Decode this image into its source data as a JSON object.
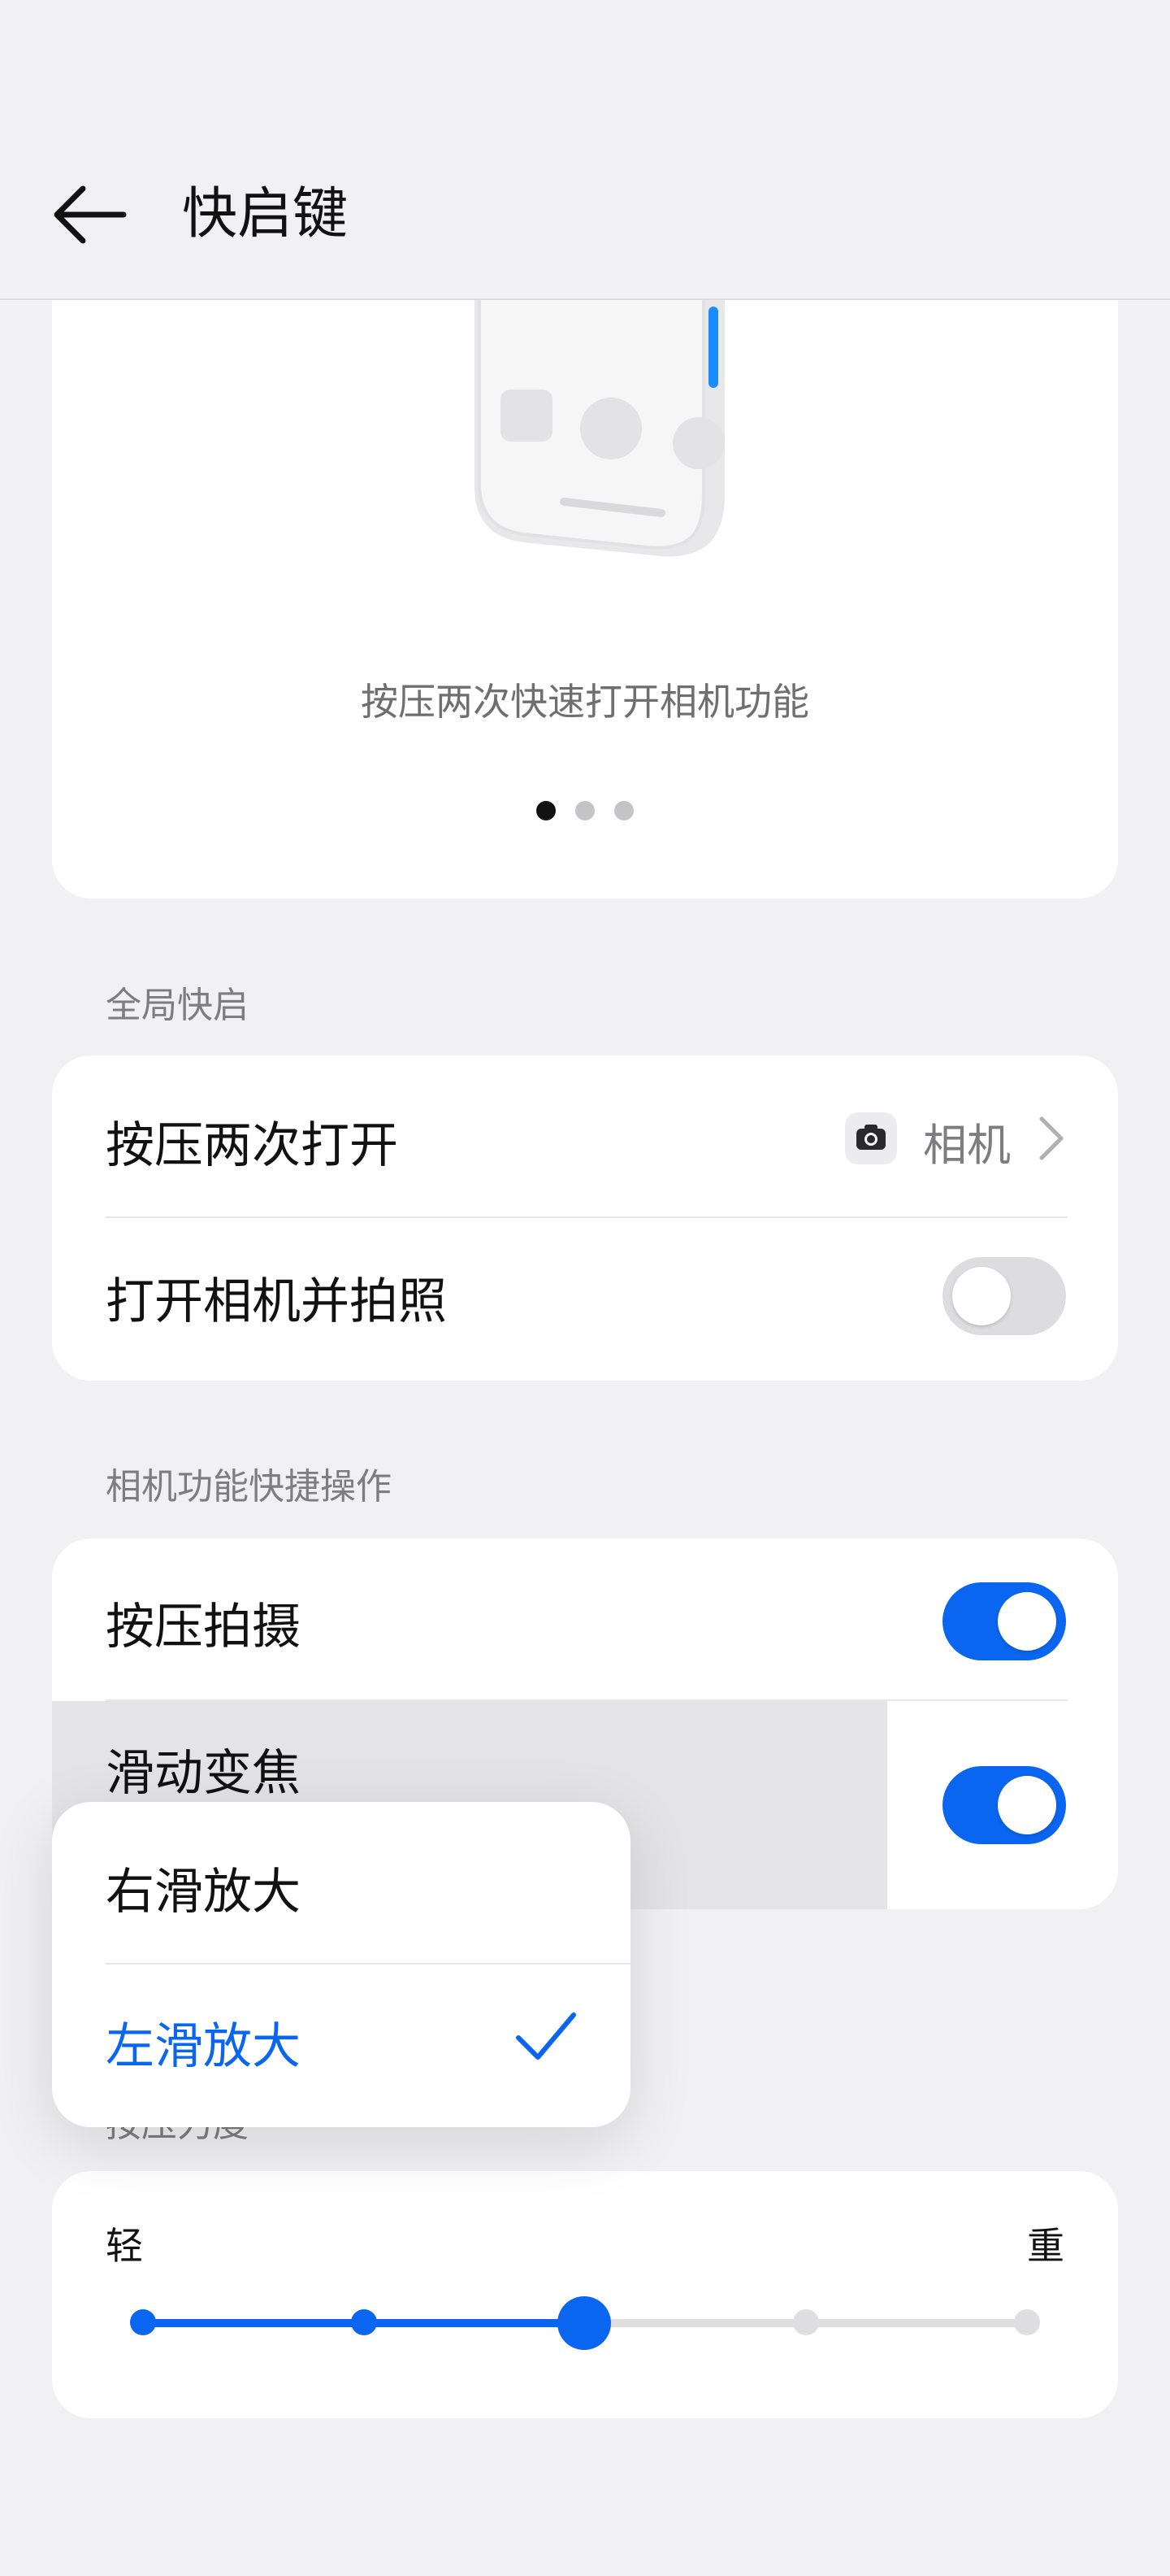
{
  "header": {
    "title": "快启键"
  },
  "illustration": {
    "caption": "按压两次快速打开相机功能",
    "dots": [
      "active",
      "inactive",
      "inactive"
    ]
  },
  "section_global": {
    "label": "全局快启",
    "double_press": {
      "title": "按压两次打开",
      "value": "相机",
      "icon": "camera-icon"
    },
    "open_camera_shoot": {
      "title": "打开相机并拍照",
      "enabled": false
    }
  },
  "section_camera": {
    "label": "相机功能快捷操作",
    "press_shoot": {
      "title": "按压拍摄",
      "enabled": true
    },
    "slide_zoom": {
      "title": "滑动变焦",
      "enabled": true
    }
  },
  "popup_menu": {
    "options": [
      "右滑放大",
      "左滑放大"
    ],
    "selected": "左滑放大"
  },
  "section_pressure": {
    "label": "按压力度",
    "min_label": "轻",
    "max_label": "重",
    "levels": 5,
    "selected_level": 3
  },
  "colors": {
    "accent": "#0a66f0",
    "background": "#f1f1f3",
    "card": "#ffffff"
  }
}
